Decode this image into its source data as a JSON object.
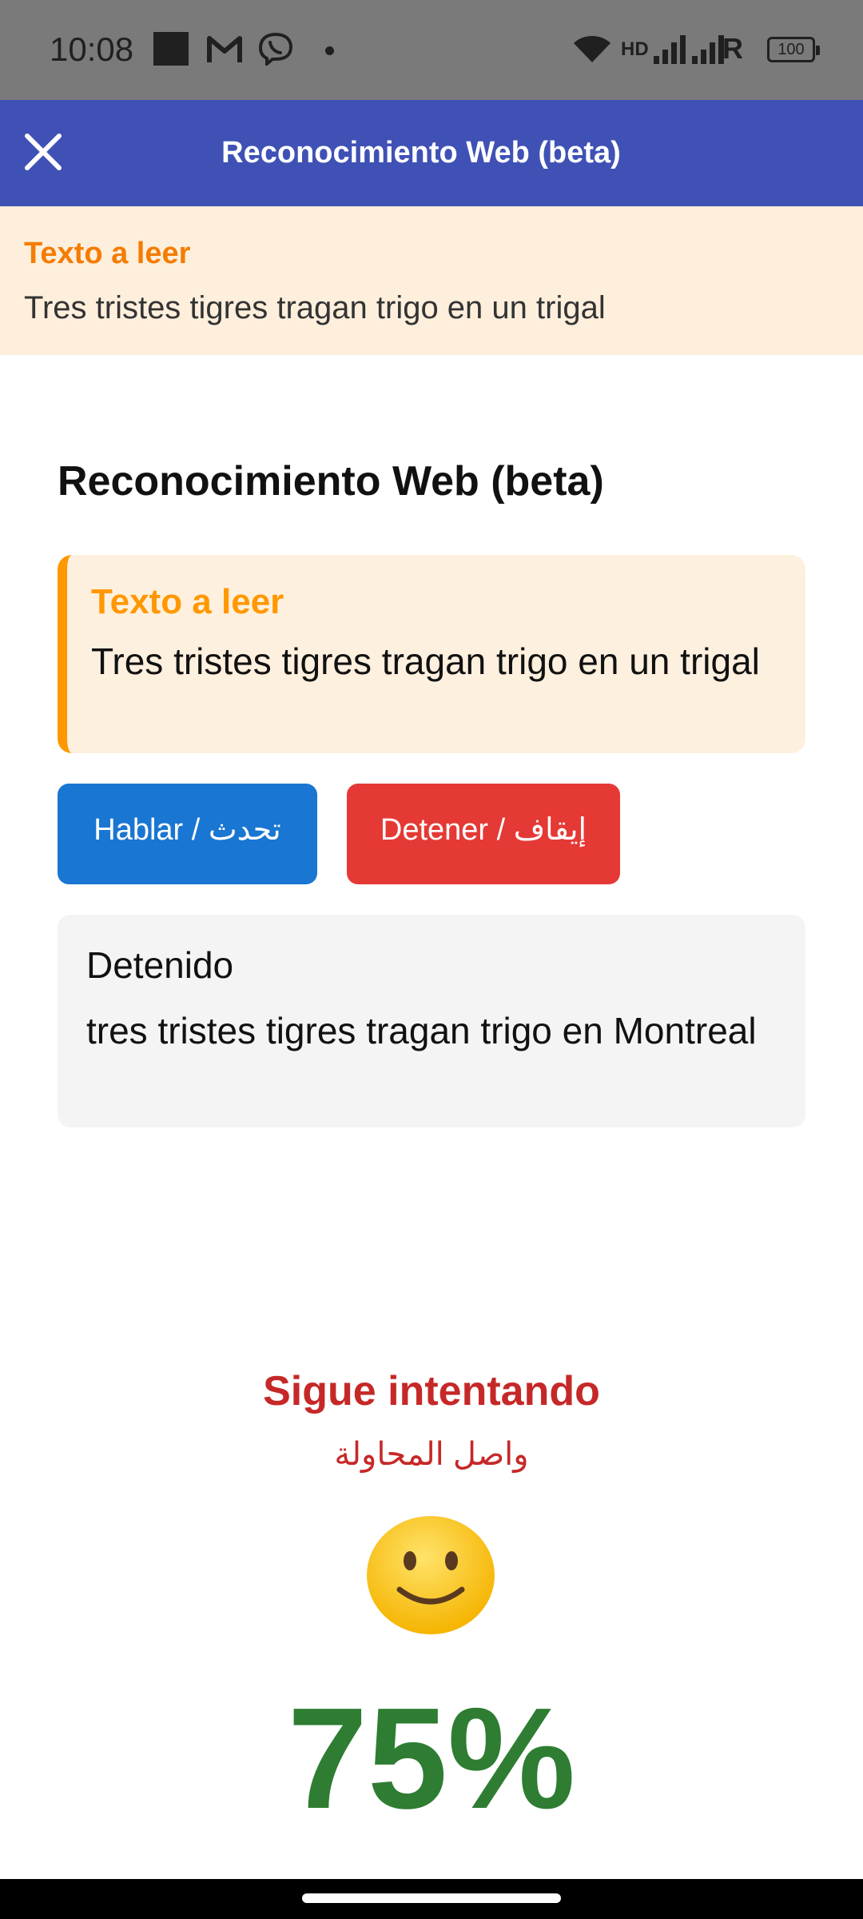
{
  "status_bar": {
    "time": "10:08",
    "network_label": "HD",
    "roaming_label": "R",
    "battery": "100"
  },
  "app_bar": {
    "title": "Reconocimiento Web (beta)"
  },
  "banner": {
    "label": "Texto a leer",
    "text": "Tres tristes tigres tragan trigo en un trigal"
  },
  "content": {
    "title": "Reconocimiento Web (beta)",
    "read_card": {
      "label": "Texto a leer",
      "text": "Tres tristes tigres tragan trigo en un trigal"
    },
    "buttons": {
      "speak": "Hablar / تحدث",
      "stop": "Detener / إيقاف"
    },
    "result": {
      "status": "Detenido",
      "transcript": "tres tristes tigres tragan trigo en Montreal"
    },
    "feedback": {
      "spanish": "Sigue intentando",
      "arabic": "واصل المحاولة",
      "emoji": "slightly-smiling-face"
    },
    "score": "75%"
  },
  "colors": {
    "app_bar": "#3f51b5",
    "accent_orange": "#ff9800",
    "speak_button": "#1976d2",
    "stop_button": "#e53935",
    "feedback_red": "#c62828",
    "score_green": "#2e7d32"
  }
}
